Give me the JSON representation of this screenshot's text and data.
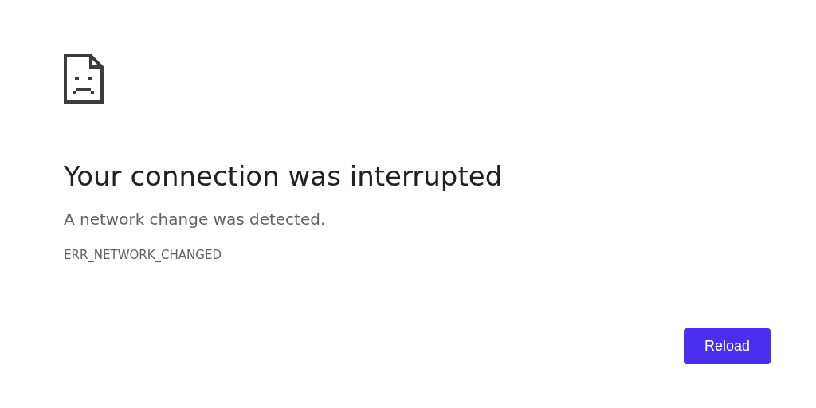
{
  "title": "Your connection was interrupted",
  "message": "A network change was detected.",
  "error_code": "ERR_NETWORK_CHANGED",
  "buttons": [
    "Reload"
  ]
}
